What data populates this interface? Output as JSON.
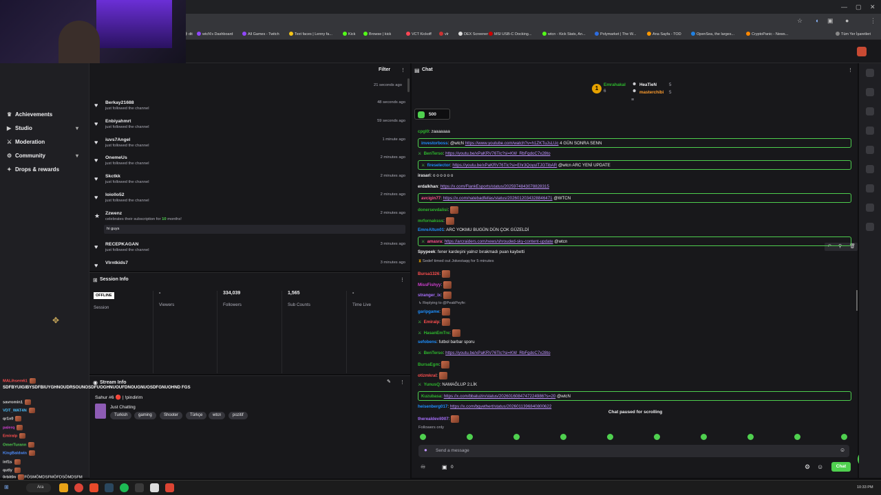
{
  "browser": {
    "bookmarks": [
      {
        "label": "dit",
        "color": "#888"
      },
      {
        "label": "wtcN's Dashboard",
        "color": "#9147ff"
      },
      {
        "label": "All Games - Twitch",
        "color": "#9147ff"
      },
      {
        "label": "Text faces | Lenny fa...",
        "color": "#f5c518"
      },
      {
        "label": "Kick",
        "color": "#53fc18"
      },
      {
        "label": "Browse | kick",
        "color": "#53fc18"
      },
      {
        "label": "VCT Kickoff",
        "color": "#ff4655"
      },
      {
        "label": "vlr",
        "color": "#c33"
      },
      {
        "label": "DEX Screener",
        "color": "#ddd"
      },
      {
        "label": "MSI USB-C Docking...",
        "color": "#c00"
      },
      {
        "label": "wtcn - Kick Stats, An...",
        "color": "#53fc18"
      },
      {
        "label": "Polymarket | The W...",
        "color": "#2d6cdf"
      },
      {
        "label": "Ana Sayfa - TOD",
        "color": "#f90"
      },
      {
        "label": "OpenSea, the larges...",
        "color": "#2081e2"
      },
      {
        "label": "CryptoPanic - News...",
        "color": "#f80"
      },
      {
        "label": "Tüm Yer İşaretleri",
        "color": "#888"
      }
    ]
  },
  "nav": {
    "items": [
      {
        "label": "Achievements",
        "icon": "trophy-icon",
        "chev": ""
      },
      {
        "label": "Studio",
        "icon": "video-icon",
        "chev": "▾"
      },
      {
        "label": "Moderation",
        "icon": "sword-icon",
        "chev": ""
      },
      {
        "label": "Community",
        "icon": "gear-icon",
        "chev": "▾"
      },
      {
        "label": "Drops & rewards",
        "icon": "gift-icon",
        "chev": ""
      }
    ]
  },
  "activity": {
    "filter_label": "Filter",
    "first_time": "21 seconds ago",
    "rows": [
      {
        "name": "Berkay21688",
        "sub": "just followed the channel",
        "time": "48 seconds ago"
      },
      {
        "name": "Enbiyahmrt",
        "sub": "just followed the channel",
        "time": "59 seconds ago"
      },
      {
        "name": "iuvs7Angel",
        "sub": "just followed the channel",
        "time": "1 minute ago"
      },
      {
        "name": "OnemeUs",
        "sub": "just followed the channel",
        "time": "2 minutes ago"
      },
      {
        "name": "Skctkk",
        "sub": "just followed the channel",
        "time": "2 minutes ago"
      },
      {
        "name": "loiollo52",
        "sub": "just followed the channel",
        "time": "2 minutes ago"
      }
    ],
    "sub_row": {
      "name": "Zzwenz",
      "pre": "celebrates their subscription for ",
      "months": "10",
      "post": " months!",
      "message": "hi guys",
      "time": "2 minutes ago"
    },
    "tail_rows": [
      {
        "name": "RECEPKAGAN",
        "sub": "just followed the channel",
        "time": "3 minutes ago"
      },
      {
        "name": "Vlrntkids7",
        "sub": "",
        "time": "3 minutes ago"
      }
    ]
  },
  "session": {
    "title": "Session Info",
    "status": "OFFLINE",
    "session_label": "Session",
    "stats": [
      {
        "value": "-",
        "label": "Viewers"
      },
      {
        "value": "334,039",
        "label": "Followers"
      },
      {
        "value": "1,565",
        "label": "Sub Counts"
      },
      {
        "value": "-",
        "label": "Time Live"
      }
    ]
  },
  "stream": {
    "title": "Stream Info",
    "overlay_text": "SDFBYUIGIBYSDFBIUYGHNOUDRSOUNOSDFUOGHNUOUFDNOUGNUOSDFGNUOHND FGS",
    "name": "Sahur #6 🔴 | !pindirim",
    "category": "Just Chatting",
    "tags": [
      "Turkish",
      "gaming",
      "Shooter",
      "Türkçe",
      "wtcn",
      "pozitif"
    ]
  },
  "chat": {
    "title": "Chat",
    "top_users": [
      {
        "name": "Emrahakal",
        "count": "6"
      },
      {
        "name": "HeaTieN",
        "count": "5"
      },
      {
        "name": "masterchibi",
        "count": "5"
      }
    ],
    "points_badge": "500",
    "paused_text": "Chat paused for scrolling",
    "followers_only": "Followers only",
    "input_placeholder": "Send a message",
    "chat_button": "Chat",
    "points_count": "0",
    "timeout_text": {
      "mod": "Sedef",
      "action": " timed out ",
      "target": "Jokestaqq",
      "duration": " for 5 minutes"
    },
    "reply_text": "Replying to @PeakPeyfe:",
    "messages": [
      {
        "user": "cpgl0",
        "color": "#2eb82e",
        "text": "zaaaaaaa",
        "link": "",
        "suffix": "",
        "hl": false,
        "emote": false
      },
      {
        "user": "investorboss",
        "color": "#1e90ff",
        "text": "@wtcN ",
        "link": "https://www.youtube.com/watch?v=h1ZKTuJsLUc",
        "suffix": " 4 GÜN SONRA SENN",
        "hl": true,
        "emote": false
      },
      {
        "user": "BenTerso",
        "color": "#2eb82e",
        "text": "",
        "link": "https://youtu.be/xPaKRV76Tlc?si=KW_RbFgdoC7x28to",
        "suffix": "",
        "hl": false,
        "emote": false
      },
      {
        "user": "fireselector",
        "color": "#1e90ff",
        "text": "",
        "link": "https://youtu.be/xPaKRV76Tlc?si=Ehr3QoyulTJGTibAR",
        "suffix": " @wtcn ARC YENİ UPDATE",
        "hl": true,
        "emote": false
      },
      {
        "user": "irasari",
        "color": "#efeff1",
        "text": "o o o o o o",
        "link": "",
        "suffix": "",
        "hl": false,
        "emote": false
      },
      {
        "user": "erdalkhan",
        "color": "#efeff1",
        "text": "",
        "link": "https://x.com/FlankEsports/status/2025974843078828315",
        "suffix": "",
        "hl": false,
        "emote": false
      },
      {
        "user": "avcigin77",
        "color": "#ff4f8b",
        "text": "",
        "link": "https://x.com/natebadfellas/status/2026012034328846471",
        "suffix": " @WTCN",
        "hl": true,
        "emote": false
      },
      {
        "user": "donersevdalisi",
        "color": "#2eb82e",
        "text": "",
        "link": "",
        "suffix": "",
        "hl": false,
        "emote": true
      },
      {
        "user": "mrfornaksss",
        "color": "#2eb82e",
        "text": "",
        "link": "",
        "suffix": "",
        "hl": false,
        "emote": true
      },
      {
        "user": "EmreAltun01",
        "color": "#1e90ff",
        "text": "ARC YOKMU BUGÜN DÜN ÇOK GÜZELDİ",
        "link": "",
        "suffix": "",
        "hl": false,
        "emote": false
      },
      {
        "user": "amasra",
        "color": "#ff4f8b",
        "text": "",
        "link": "https://arcraiders.com/news/shrouded-sky-content-update",
        "suffix": " @wtcn",
        "hl": true,
        "emote": false
      },
      {
        "user": "Spypeek",
        "color": "#efeff1",
        "text": "fener kardeşini yalnız bırakmadı puan kaybetti",
        "link": "",
        "suffix": "",
        "hl": false,
        "emote": false
      },
      {
        "user": "Bursa1326",
        "color": "#ff4f4f",
        "text": "",
        "link": "",
        "suffix": "",
        "hl": false,
        "emote": true
      },
      {
        "user": "MissFishyy",
        "color": "#d040d0",
        "text": "",
        "link": "",
        "suffix": "",
        "hl": false,
        "emote": true
      },
      {
        "user": "stranger_ix",
        "color": "#a970ff",
        "text": "",
        "link": "",
        "suffix": "",
        "hl": false,
        "emote": true
      },
      {
        "user": "garipgame",
        "color": "#1e90ff",
        "text": "",
        "link": "",
        "suffix": "",
        "hl": false,
        "emote": true
      },
      {
        "user": "Emiralp",
        "color": "#ff4f4f",
        "text": "",
        "link": "",
        "suffix": "",
        "hl": false,
        "emote": true
      },
      {
        "user": "HasanEmTre",
        "color": "#2eb82e",
        "text": "",
        "link": "",
        "suffix": "",
        "hl": false,
        "emote": true
      },
      {
        "user": "sefobens",
        "color": "#1e90ff",
        "text": "futbol barbar sporu",
        "link": "",
        "suffix": "",
        "hl": false,
        "emote": false
      },
      {
        "user": "BenTerso",
        "color": "#2eb82e",
        "text": "",
        "link": "https://youtu.be/xPaKRV76Tlc?si=KW_RbFgdoC7x28to",
        "suffix": "",
        "hl": false,
        "emote": false
      },
      {
        "user": "BursaEgm",
        "color": "#2eb82e",
        "text": "",
        "link": "",
        "suffix": "",
        "hl": false,
        "emote": true
      },
      {
        "user": "otizmkral",
        "color": "#ff4f4f",
        "text": "",
        "link": "",
        "suffix": "",
        "hl": false,
        "emote": true
      },
      {
        "user": "YunusQ",
        "color": "#2eb82e",
        "text": "NAMAĞLUP 2.LİK",
        "link": "",
        "suffix": "",
        "hl": false,
        "emote": false
      },
      {
        "user": "Kuzubasa",
        "color": "#2eb82e",
        "text": "",
        "link": "https://x.com/bbatuzin/status/2026016084747224986?s=20",
        "suffix": " @wtcN",
        "hl": true,
        "emote": false
      },
      {
        "user": "heisenberg017",
        "color": "#1e90ff",
        "text": "",
        "link": "https://x.com/bgyethert/status/2026011396840800622",
        "suffix": "",
        "hl": false,
        "emote": false
      },
      {
        "user": "therealdevil007",
        "color": "#a970ff",
        "text": "",
        "link": "",
        "suffix": "",
        "hl": false,
        "emote": true
      }
    ]
  },
  "overlay_chat": [
    {
      "user": "MALihsem61",
      "text": ""
    },
    {
      "user": "savromin1",
      "text": ""
    },
    {
      "user": "VDT_WAT4N",
      "text": ""
    },
    {
      "user": "qr1x0",
      "text": ""
    },
    {
      "user": "palerq",
      "text": ""
    },
    {
      "user": "Emiralp",
      "text": ""
    },
    {
      "user": "OmerTurann",
      "text": ""
    },
    {
      "user": "KingBaldwin",
      "text": ""
    },
    {
      "user": "inf1s",
      "text": ""
    },
    {
      "user": "qutly",
      "text": ""
    },
    {
      "user": "0rbit0n",
      "text": "FÖSMÖMDSFMÖFDSÖMDSFM"
    }
  ],
  "taskbar": {
    "search_label": "Ara",
    "clock": "10:33 PM"
  },
  "colors": {
    "accent": "#4fd04f",
    "twitch_purple": "#9147ff"
  }
}
